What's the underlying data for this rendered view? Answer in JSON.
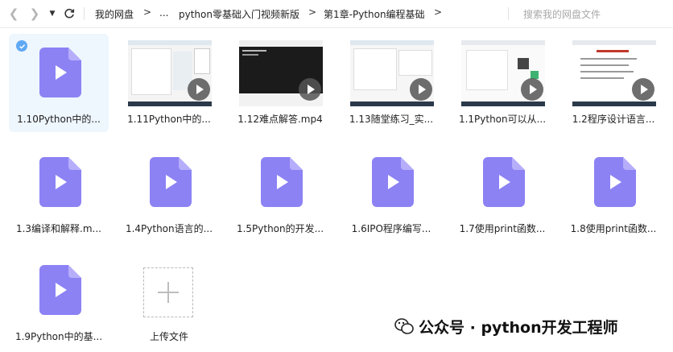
{
  "toolbar": {
    "back_icon": "chevron-left-icon",
    "forward_icon": "chevron-right-icon",
    "dropdown_icon": "caret-down-icon",
    "refresh_icon": "refresh-icon"
  },
  "breadcrumb": {
    "items": [
      "我的网盘",
      "...",
      "python零基础入门视频新版",
      "第1章-Python编程基础"
    ],
    "separator": ">"
  },
  "search": {
    "placeholder": "搜索我的网盘文件"
  },
  "files": [
    {
      "label": "1.10Python中的...",
      "kind": "video-file",
      "selected": true
    },
    {
      "label": "1.11Python中的...",
      "kind": "video-thumb"
    },
    {
      "label": "1.12难点解答.mp4",
      "kind": "video-thumb"
    },
    {
      "label": "1.13随堂练习_实...",
      "kind": "video-thumb"
    },
    {
      "label": "1.1Python可以从...",
      "kind": "video-thumb"
    },
    {
      "label": "1.2程序设计语言...",
      "kind": "video-thumb"
    },
    {
      "label": "1.3编译和解释.m...",
      "kind": "video-file"
    },
    {
      "label": "1.4Python语言的...",
      "kind": "video-file"
    },
    {
      "label": "1.5Python的开发...",
      "kind": "video-file"
    },
    {
      "label": "1.6IPO程序编写...",
      "kind": "video-file"
    },
    {
      "label": "1.7使用print函数...",
      "kind": "video-file"
    },
    {
      "label": "1.8使用print函数...",
      "kind": "video-file"
    },
    {
      "label": "1.9Python中的基...",
      "kind": "video-file"
    }
  ],
  "upload": {
    "label": "上传文件",
    "icon": "plus-icon"
  },
  "watermark": {
    "text": "公众号 · python开发工程师",
    "icon": "wechat-icon"
  },
  "colors": {
    "file_icon": "#8c82f4",
    "accent": "#5fa8f3",
    "selected_bg": "#eef6fe"
  }
}
